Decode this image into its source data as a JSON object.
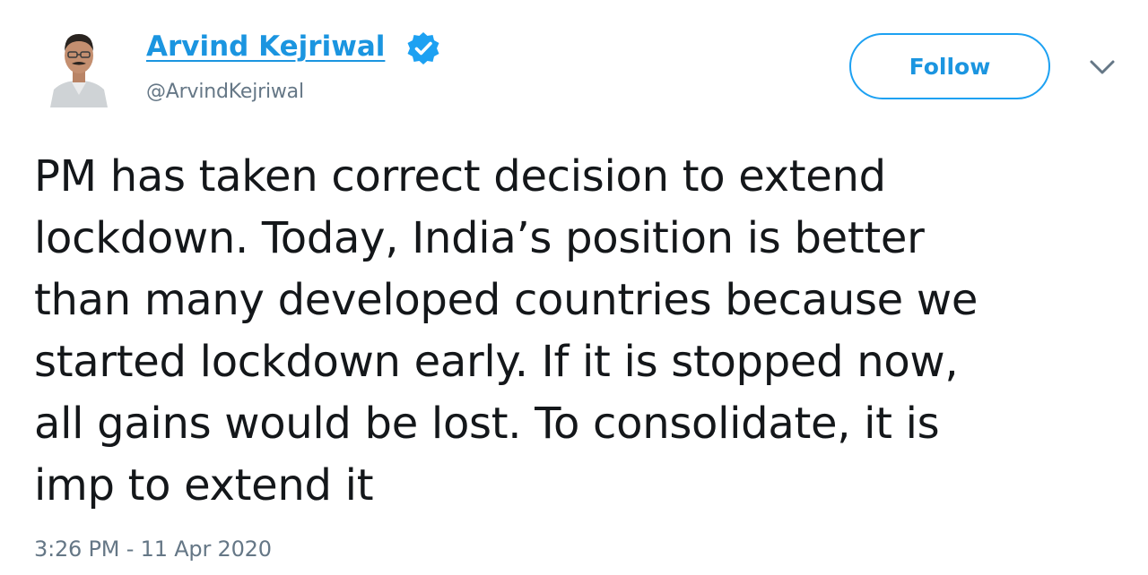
{
  "author": {
    "display_name": "Arvind Kejriwal",
    "handle": "@ArvindKejriwal",
    "verified": true,
    "avatar_icon": "profile-photo"
  },
  "actions": {
    "follow_label": "Follow",
    "more_icon": "chevron-down-icon"
  },
  "tweet": {
    "lines": [
      "PM has taken correct decision to extend",
      "lockdown. Today, India’s position is better",
      "than many developed countries because we",
      "started lockdown early. If it is stopped now,",
      "all gains would be lost. To consolidate, it is",
      "imp to extend it"
    ],
    "timestamp": "3:26 PM - 11 Apr 2020"
  },
  "colors": {
    "link_blue": "#1b95e0",
    "border_blue": "#1da1f2",
    "text": "#14171a",
    "secondary": "#657786"
  }
}
